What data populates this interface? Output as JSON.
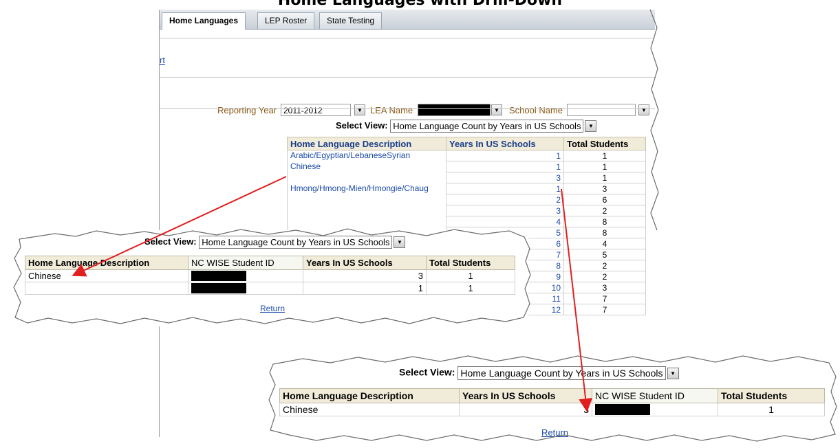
{
  "title": "Home Languages with Drill-Down",
  "tabs": [
    {
      "label": "Home Languages"
    },
    {
      "label": "LEP Roster"
    },
    {
      "label": "State Testing"
    }
  ],
  "link_fragment": "rt",
  "filters": {
    "reporting_year_label": "Reporting Year",
    "reporting_year_value": "2011-2012",
    "lea_label": "LEA Name",
    "school_label": "School Name"
  },
  "main_view": {
    "select_label": "Select View:",
    "select_value": "Home Language Count by Years in US Schools",
    "headers": [
      "Home Language Description",
      "Years In US Schools",
      "Total Students"
    ],
    "rows": [
      {
        "lang": "Arabic/Egyptian/LebaneseSyrian",
        "years": "1",
        "total": "1"
      },
      {
        "lang": "Chinese",
        "years": "1",
        "total": "1"
      },
      {
        "lang": "",
        "years": "3",
        "total": "1"
      },
      {
        "lang": "Hmong/Hmong-Mien/Hmongie/Chaug",
        "years": "1",
        "total": "3"
      },
      {
        "lang": "",
        "years": "2",
        "total": "6"
      },
      {
        "lang": "",
        "years": "3",
        "total": "2"
      },
      {
        "lang": "",
        "years": "4",
        "total": "8"
      },
      {
        "lang": "",
        "years": "5",
        "total": "8"
      },
      {
        "lang": "",
        "years": "6",
        "total": "4"
      },
      {
        "lang": "",
        "years": "7",
        "total": "5"
      },
      {
        "lang": "",
        "years": "8",
        "total": "2"
      },
      {
        "lang": "",
        "years": "9",
        "total": "2"
      },
      {
        "lang": "",
        "years": "10",
        "total": "3"
      },
      {
        "lang": "",
        "years": "11",
        "total": "7"
      },
      {
        "lang": "",
        "years": "12",
        "total": "7"
      }
    ]
  },
  "popup_left": {
    "select_label": "Select View:",
    "select_value": "Home Language Count by Years in US Schools",
    "headers": [
      "Home Language Description",
      "NC WISE Student ID",
      "Years In US Schools",
      "Total Students"
    ],
    "rows": [
      {
        "lang": "Chinese",
        "years": "3",
        "total": "1"
      },
      {
        "lang": "",
        "years": "1",
        "total": "1"
      }
    ],
    "return_label": "Return"
  },
  "popup_right": {
    "select_label": "Select View:",
    "select_value": "Home Language Count by Years in US Schools",
    "headers": [
      "Home Language Description",
      "Years In US Schools",
      "NC WISE Student ID",
      "Total Students"
    ],
    "rows": [
      {
        "lang": "Chinese",
        "years": "3",
        "total": "1"
      }
    ],
    "return_label": "Return"
  },
  "colors": {
    "header_bg": "#f1ecd9",
    "link_blue": "#1a4aa8",
    "arrow_red": "#e02020",
    "label_brown": "#8a5a14"
  },
  "icons": {
    "dropdown": "chevron-down-icon"
  }
}
